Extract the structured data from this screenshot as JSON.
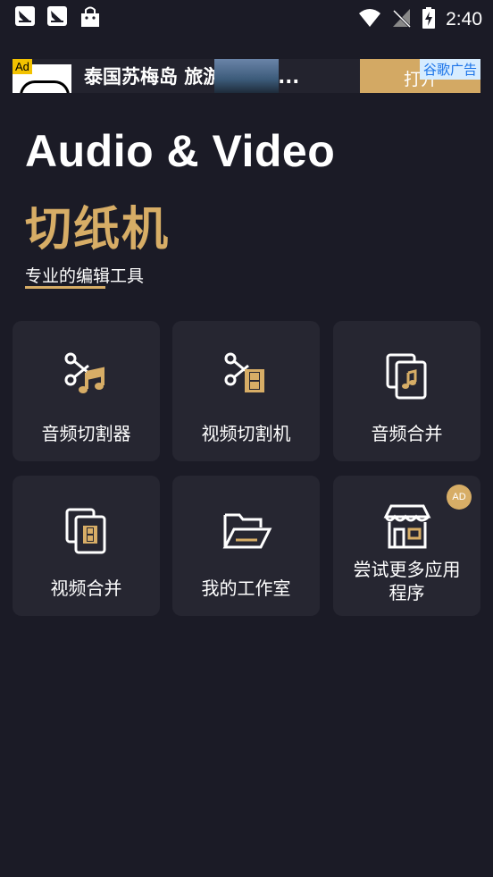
{
  "status_bar": {
    "time": "2:40",
    "left_icons": [
      "notification-bird-icon",
      "notification-bird-icon",
      "shopping-bag-icon"
    ],
    "right_icons": [
      "wifi-icon",
      "signal-off-icon",
      "battery-charging-icon"
    ]
  },
  "ad_banner": {
    "tag": "Ad",
    "title": "泰国苏梅岛 旅游住宿省...",
    "cta": "打开",
    "provider": "谷歌广告"
  },
  "header": {
    "title_en": "Audio & Video",
    "title_cn": "切纸机",
    "subtitle": "专业的编辑工具"
  },
  "tiles": [
    {
      "label": "音频切割器",
      "icon": "scissors-music-icon"
    },
    {
      "label": "视频切割机",
      "icon": "scissors-film-icon"
    },
    {
      "label": "音频合并",
      "icon": "audio-merge-icon"
    },
    {
      "label": "视频合并",
      "icon": "video-merge-icon"
    },
    {
      "label": "我的工作室",
      "icon": "folder-open-icon"
    },
    {
      "label": "尝试更多应用程序",
      "icon": "store-icon",
      "badge": "AD"
    }
  ],
  "colors": {
    "background": "#1b1b26",
    "tile": "#262631",
    "accent": "#d7ad66"
  }
}
